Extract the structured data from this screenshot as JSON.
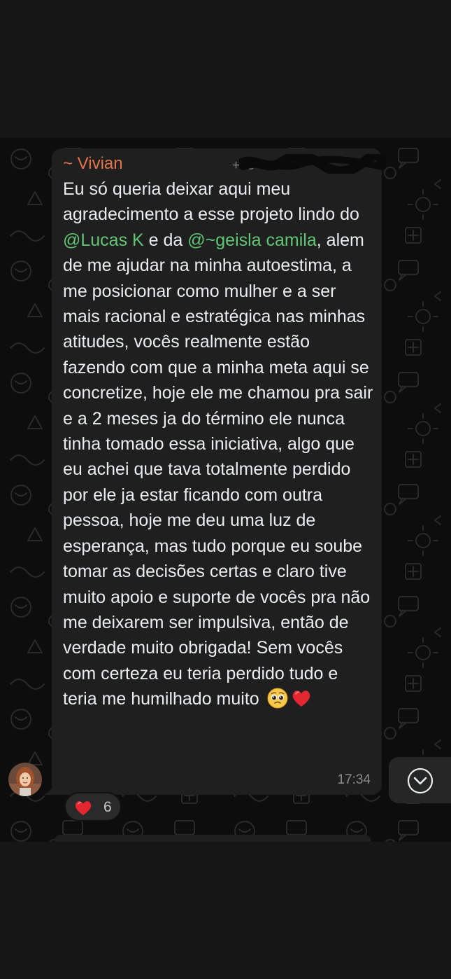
{
  "message": {
    "sender_name": "~ Vivian",
    "sender_phone": "+55",
    "body_segments": [
      {
        "type": "text",
        "value": "Eu só queria deixar aqui meu agradecimento a esse projeto lindo do "
      },
      {
        "type": "mention",
        "value": "@Lucas K"
      },
      {
        "type": "text",
        "value": " e da "
      },
      {
        "type": "mention",
        "value": "@~geisla camila"
      },
      {
        "type": "text",
        "value": ", alem de me ajudar na minha autoestima, a me posicionar como mulher e a ser mais racional e estratégica nas minhas atitudes, vocês realmente estão fazendo com que a minha meta aqui se concretize, hoje ele me chamou pra sair e a 2 meses ja do término ele nunca tinha tomado essa iniciativa, algo que eu achei que tava totalmente perdido por ele ja estar ficando com outra pessoa, hoje me deu uma luz de esperança, mas tudo porque eu soube tomar as decisões certas e claro tive muito apoio e suporte de vocês pra não me deixarem ser impulsiva, então de verdade muito obrigada! Sem vocês com certeza eu teria perdido tudo e teria me humilhado muito"
      }
    ],
    "trailing_emojis": [
      "pleading-face-emoji",
      "red-heart-emoji"
    ],
    "time": "17:34",
    "reaction": {
      "emoji": "red-heart-emoji",
      "count": "6"
    }
  },
  "icons": {
    "scroll_down": "chevron-down-circle-icon"
  },
  "colors": {
    "background": "#0d0d0d",
    "bubble": "#1f1f1f",
    "sender": "#e5734a",
    "mention": "#5fc773",
    "text": "#e9edef",
    "timestamp": "#8c8c8c",
    "heart": "#e3262f"
  }
}
